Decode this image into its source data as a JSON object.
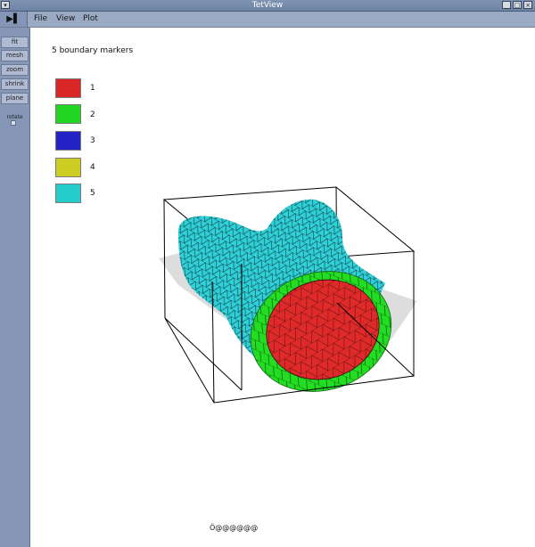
{
  "window": {
    "title": "TetView",
    "system_icon": "chevron-down-icon",
    "controls": [
      "_",
      "□",
      "×"
    ]
  },
  "menubar": {
    "play_icon": "▶▌",
    "items": [
      "File",
      "View",
      "Plot"
    ]
  },
  "toolbar": {
    "buttons": [
      "fit",
      "mesh",
      "zoom",
      "shrink",
      "plane"
    ],
    "spin_label": "rotate"
  },
  "canvas": {
    "heading": "5 boundary markers",
    "legend": [
      {
        "label": "1",
        "color": "#d92626"
      },
      {
        "label": "2",
        "color": "#22d622"
      },
      {
        "label": "3",
        "color": "#2323c8"
      },
      {
        "label": "4",
        "color": "#cccc22"
      },
      {
        "label": "5",
        "color": "#25cccc"
      }
    ],
    "status": "Ӧ@@@@@@"
  },
  "colors": {
    "titlebar": "#7386a8",
    "menubar": "#9aaac4",
    "toolbar": "#8596b6",
    "mesh_cyan": "#30d0d8",
    "mesh_red": "#e02a2a",
    "ring_green": "#22dd22",
    "plane_gray": "#d4d4d4"
  }
}
